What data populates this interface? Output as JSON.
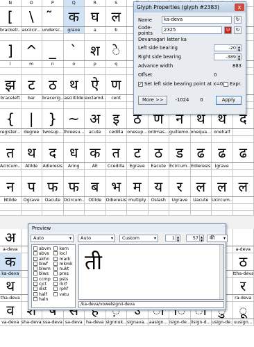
{
  "top_grid": [
    {
      "names": [
        "N",
        "O",
        "P",
        "Q",
        "R",
        "S",
        "T",
        "U",
        "V",
        "W",
        "X",
        "Y"
      ],
      "glyphs": [
        "[",
        "\\",
        "̃",
        "क",
        "घ",
        "ल",
        "",
        "",
        "",
        "",
        "",
        ""
      ],
      "labels": [
        "bracketr...",
        "asciicir...",
        "undersc...",
        "grave",
        "a",
        "b",
        "",
        "",
        "",
        "",
        "",
        ""
      ]
    },
    {
      "names": [
        "",
        "",
        "",
        "",
        "",
        "",
        "",
        "",
        "",
        "",
        "",
        ""
      ],
      "glyphs": [
        "]",
        "^",
        "_",
        "`",
        "श",
        "े",
        "",
        "",
        "",
        "",
        "",
        ""
      ],
      "labels": [
        "l",
        "m",
        "n",
        "o",
        "p",
        "q",
        "",
        "",
        "",
        "",
        "",
        ""
      ]
    },
    {
      "names": [
        "",
        "",
        "",
        "",
        "",
        "",
        "",
        "",
        "",
        "",
        "",
        ""
      ],
      "glyphs": [
        "झ",
        "ट",
        "ठ",
        "थ",
        "ऐ",
        "ण",
        "",
        "",
        "",
        "",
        "",
        ""
      ],
      "labels": [
        "braceleft",
        "bar",
        "bracerig...",
        "asciitilde",
        "exclamd...",
        "cent",
        "",
        "",
        "",
        "",
        "",
        ""
      ]
    },
    {
      "names": [
        "",
        "",
        "",
        "",
        "",
        "",
        "",
        "",
        "",
        "",
        "",
        ""
      ],
      "glyphs": [
        "{",
        "|",
        "}",
        "~",
        "अ",
        "इ",
        "ठ",
        "ण",
        "न",
        "थ",
        "थ",
        "द"
      ],
      "labels": [
        "register...",
        "degree",
        "twosup...",
        "threesu...",
        "acute",
        "cedilla",
        "onesup...",
        "ordmas...",
        "guillemo...",
        "onequa...",
        "onehalf",
        ""
      ]
    },
    {
      "names": [
        "",
        "",
        "",
        "",
        "",
        "",
        "",
        "",
        "",
        "",
        "",
        ""
      ],
      "glyphs": [
        "त",
        "थ",
        "द",
        "ध",
        "क",
        "त",
        "ट",
        "ठ",
        "ड",
        "ढ",
        "ढ",
        "ढ"
      ],
      "labels": [
        "Acircum...",
        "Atilde",
        "Adieresis",
        "Aring",
        "AE",
        "Ccedilla",
        "Egrave",
        "Eacute",
        "Ecircum...",
        "Edieresis",
        "Igrave",
        ""
      ]
    },
    {
      "names": [
        "",
        "",
        "",
        "",
        "",
        "",
        "",
        "",
        "",
        "",
        "",
        ""
      ],
      "glyphs": [
        "न",
        "प",
        "फ",
        "फ",
        "ब",
        "भ",
        "म",
        "य",
        "र",
        "ल",
        "ल",
        "ल"
      ],
      "labels": [
        "Ntilde",
        "Ograve",
        "Oacute",
        "Ocircum...",
        "Otilde",
        "Odieresis",
        "multiply",
        "Oslash",
        "Ugrave",
        "Uacute",
        "Ucircum...",
        ""
      ]
    },
    {
      "names": [
        "",
        "",
        "",
        "",
        "",
        "",
        "",
        "",
        "",
        "",
        "",
        ""
      ],
      "glyphs": [
        "ल",
        "ळ",
        "ळ",
        "व",
        "स",
        "ह",
        "ल",
        "त",
        "त",
        "र",
        "र",
        "र"
      ],
      "labels": [
        "agrave",
        "aacute",
        "acircum...",
        "atilde",
        "adieresis",
        "aring",
        "ae",
        "ccedilla",
        "egrave",
        "eacute",
        "ecircum...",
        ""
      ]
    }
  ],
  "bottom_grid": [
    {
      "labels": [
        "a-deva",
        "",
        "",
        "",
        "",
        "",
        "",
        "",
        "",
        "",
        "",
        "a-deva"
      ],
      "glyphs": [
        "अ",
        "",
        "",
        "",
        "",
        "",
        "",
        "",
        "",
        "",
        "",
        ""
      ]
    },
    {
      "labels": [
        "ka-deva",
        "",
        "",
        "",
        "",
        "",
        "",
        "",
        "",
        "",
        "",
        "ttha-deva"
      ],
      "glyphs": [
        "क",
        "",
        "",
        "",
        "",
        "",
        "",
        "",
        "",
        "",
        "",
        "ठ"
      ]
    },
    {
      "labels": [
        "tha-deva",
        "",
        "",
        "",
        "",
        "",
        "",
        "",
        "",
        "",
        "",
        "ra-deva"
      ],
      "glyphs": [
        "थ",
        "",
        "",
        "",
        "",
        "",
        "",
        "",
        "",
        "",
        "",
        "र"
      ]
    },
    {
      "labels": [
        "va-deva",
        "sha-deva",
        "ssa-deva",
        "sa-deva",
        "ha-deva",
        "signnuk...",
        "signava...",
        "aasign...",
        "isign-de...",
        "iisign-d...",
        "usign-de...",
        "uusign..."
      ],
      "glyphs": [
        "व",
        "श",
        "ष",
        "स",
        "ह",
        "़",
        "ऽ",
        "ा",
        "ि",
        "ी",
        "ु",
        "ू"
      ]
    }
  ],
  "glyph_props": {
    "title": "Glyph Properties (glyph #2383)",
    "close": "x",
    "name_label": "Name",
    "name_value": "ka-deva",
    "codepoints_label": "Code-points",
    "codepoints_value": "2325",
    "description": "Devanagari letter ka",
    "lsb_label": "Left side bearing",
    "lsb_value": "-20",
    "rsb_label": "Right side bearing",
    "rsb_value": "-389",
    "adv_label": "Advance width",
    "adv_value": "883",
    "offset_label": "Offset",
    "offset_value": "0",
    "set_lsb_label": "Set left side bearing point at x=0",
    "expr_label": "Expr.",
    "more_label": "More >>",
    "val1": "-1024",
    "val2": "0",
    "apply_label": "Apply"
  },
  "preview": {
    "title": "Preview",
    "script_dd": "Auto",
    "lang_dd": "Auto",
    "mode_dd": "Custom",
    "spin1": "1",
    "spin2": "57",
    "glyph_field": "की",
    "features_col1": [
      "abvm",
      "abvs",
      "akhn",
      "blwf",
      "blwm",
      "blws",
      "ccmp",
      "cjct",
      "dist",
      "half",
      "haln"
    ],
    "features_col2": [
      "kern",
      "locl",
      "mark",
      "mkmk",
      "nukt",
      "pres",
      "psts",
      "rkrf",
      "rphf",
      "vatu"
    ],
    "preview_text": "ती",
    "path": "/ka-deva/vowelsignii-deva"
  },
  "colors": {
    "selection": "#cfe2f6",
    "dialog_bg": "#e8ecf1",
    "title_bar": "#b9cce3",
    "close_red": "#c94d3d"
  }
}
